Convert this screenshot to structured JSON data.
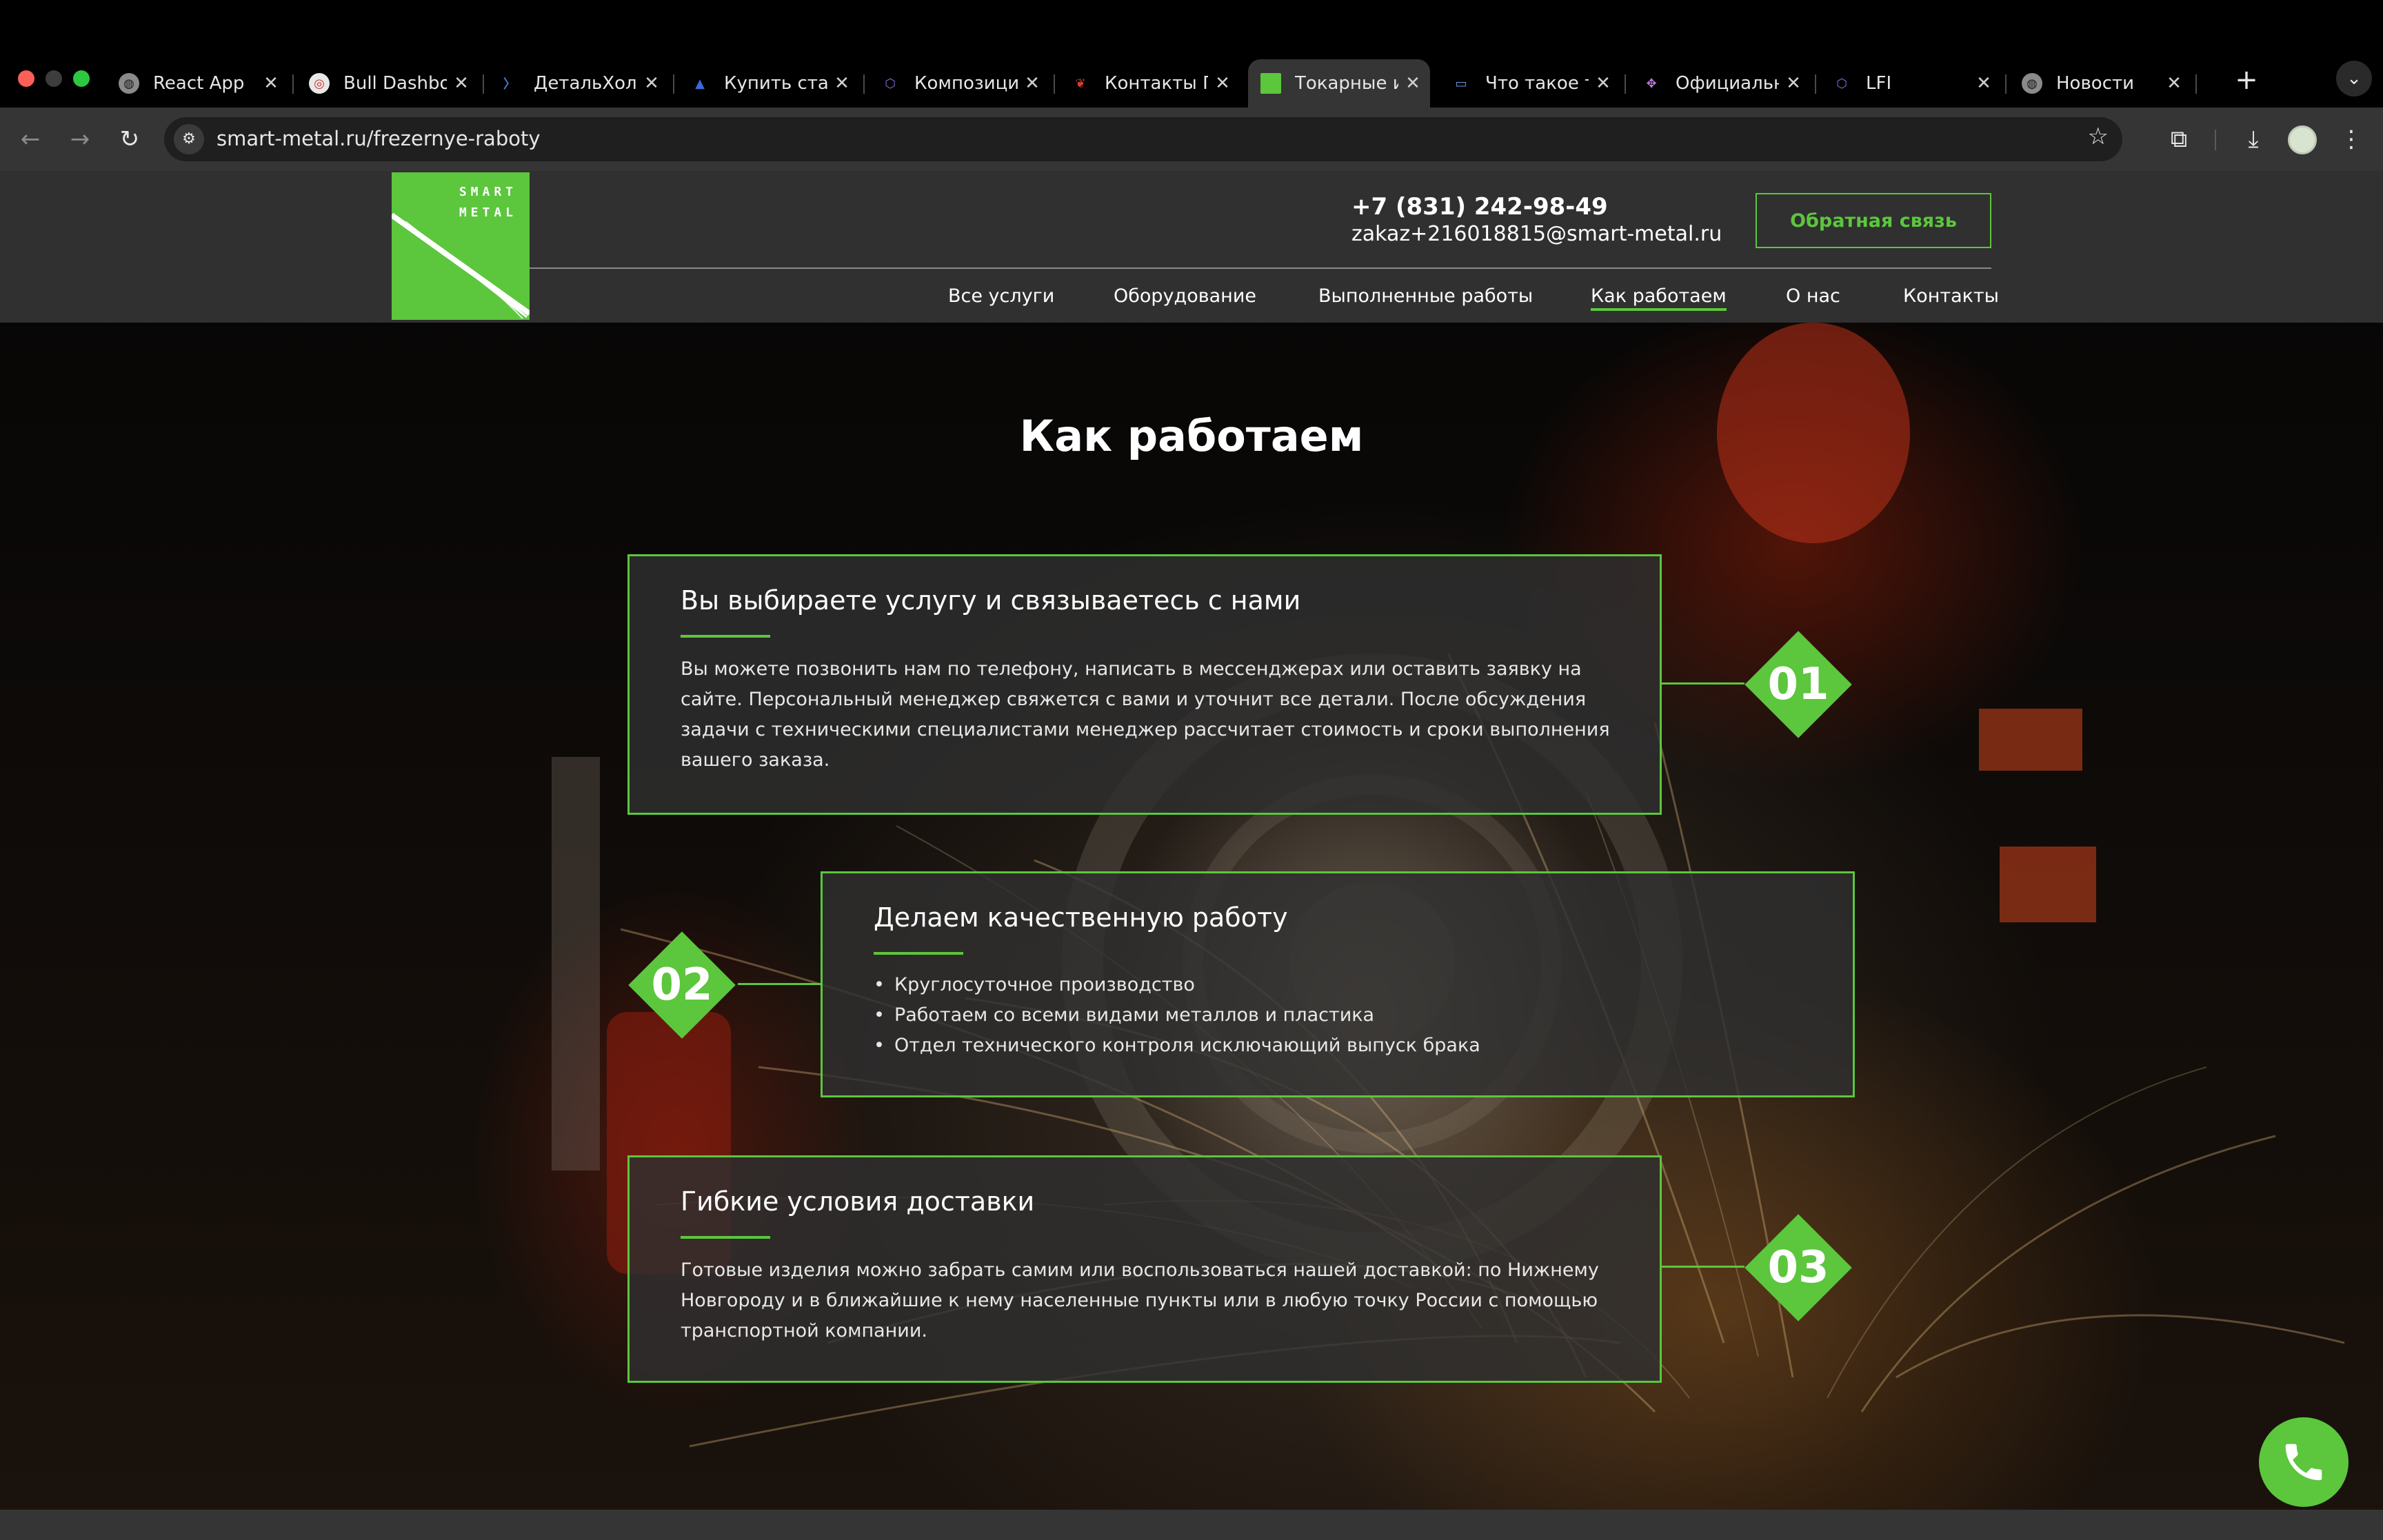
{
  "browser": {
    "tabs": [
      {
        "label": "React App",
        "icon": "globe-icon",
        "active": false
      },
      {
        "label": "Bull Dashboard",
        "icon": "target-icon",
        "active": false
      },
      {
        "label": "ДетальХолдинг",
        "icon": "detal-favicon",
        "active": false
      },
      {
        "label": "Купить станок",
        "icon": "triangle-favicon",
        "active": false
      },
      {
        "label": "Композиции",
        "icon": "cube-icon",
        "active": false
      },
      {
        "label": "Контакты П",
        "icon": "flame-favicon",
        "active": false
      },
      {
        "label": "Токарные и",
        "icon": "smart-metal-favicon",
        "active": true
      },
      {
        "label": "Что такое т",
        "icon": "card-icon",
        "active": false
      },
      {
        "label": "Официальн",
        "icon": "puzzle-favicon",
        "active": false
      },
      {
        "label": "LFI",
        "icon": "cube-icon",
        "active": false
      },
      {
        "label": "Новости",
        "icon": "globe-icon",
        "active": false
      }
    ],
    "url": "smart-metal.ru/frezernye-raboty"
  },
  "header": {
    "logo_line1": "SMART",
    "logo_line2": "METAL",
    "phone": "+7 (831) 242-98-49",
    "email": "zakaz+216018815@smart-metal.ru",
    "callback_label": "Обратная связь",
    "nav": [
      {
        "label": "Все услуги",
        "active": false
      },
      {
        "label": "Оборудование",
        "active": false
      },
      {
        "label": "Выполненные работы",
        "active": false
      },
      {
        "label": "Как работаем",
        "active": true
      },
      {
        "label": "О нас",
        "active": false
      },
      {
        "label": "Контакты",
        "active": false
      }
    ]
  },
  "page": {
    "title": "Как работаем",
    "steps": [
      {
        "number": "01",
        "title": "Вы выбираете услугу и связываетесь с нами",
        "text_lines": [
          "Вы можете позвонить нам по телефону, написать в мессенджерах или оставить заявку на",
          "сайте. Персональный менеджер свяжется с вами и уточнит все детали. После обсуждения",
          "задачи с техническими специалистами менеджер рассчитает стоимость и сроки выполнения",
          "вашего заказа."
        ]
      },
      {
        "number": "02",
        "title": "Делаем качественную работу",
        "bullets": [
          "Круглосуточное производство",
          "Работаем со всеми видами металлов и пластика",
          "Отдел технического контроля исключающий выпуск брака"
        ]
      },
      {
        "number": "03",
        "title": "Гибкие условия доставки",
        "text_lines": [
          "Готовые изделия можно забрать самим или воспользоваться нашей доставкой: по Нижнему",
          "Новгороду и в ближайшие к нему населенные пункты или в любую точку России с помощью",
          "транспортной компании."
        ]
      }
    ]
  },
  "colors": {
    "accent": "#5cc63d",
    "header_bg": "#323232",
    "card_bg": "#303030",
    "chrome_bg": "#353535"
  }
}
